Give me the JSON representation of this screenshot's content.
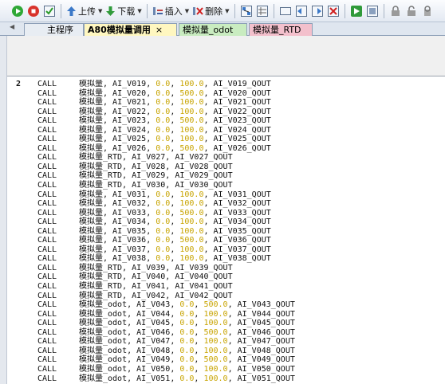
{
  "toolbar": {
    "upload_label": "上传",
    "download_label": "下载",
    "insert_label": "插入",
    "delete_label": "删除"
  },
  "tabs": [
    {
      "label": "主程序",
      "color": "#e8edf3"
    },
    {
      "label": "A80模拟量调用",
      "color": "#fff7c0",
      "active": true,
      "close": "×"
    },
    {
      "label": "模拟量_odot",
      "color": "#c9ecc0"
    },
    {
      "label": "模拟量_RTD",
      "color": "#f3c0cc"
    }
  ],
  "editor": {
    "line_number": "2",
    "lines": [
      {
        "kw": "CALL",
        "fn": "模拟量",
        "args": [
          "AI_V019",
          "0.0",
          "100.0",
          "AI_V019_QOUT"
        ]
      },
      {
        "kw": "CALL",
        "fn": "模拟量",
        "args": [
          "AI_V020",
          "0.0",
          "500.0",
          "AI_V020_QOUT"
        ]
      },
      {
        "kw": "CALL",
        "fn": "模拟量",
        "args": [
          "AI_V021",
          "0.0",
          "100.0",
          "AI_V021_QOUT"
        ]
      },
      {
        "kw": "CALL",
        "fn": "模拟量",
        "args": [
          "AI_V022",
          "0.0",
          "100.0",
          "AI_V022_QOUT"
        ]
      },
      {
        "kw": "CALL",
        "fn": "模拟量",
        "args": [
          "AI_V023",
          "0.0",
          "500.0",
          "AI_V023_QOUT"
        ]
      },
      {
        "kw": "CALL",
        "fn": "模拟量",
        "args": [
          "AI_V024",
          "0.0",
          "100.0",
          "AI_V024_QOUT"
        ]
      },
      {
        "kw": "CALL",
        "fn": "模拟量",
        "args": [
          "AI_V025",
          "0.0",
          "100.0",
          "AI_V025_QOUT"
        ]
      },
      {
        "kw": "CALL",
        "fn": "模拟量",
        "args": [
          "AI_V026",
          "0.0",
          "500.0",
          "AI_V026_QOUT"
        ]
      },
      {
        "kw": "CALL",
        "fn": "模拟量_RTD",
        "args": [
          "AI_V027",
          "AI_V027_QOUT"
        ]
      },
      {
        "kw": "CALL",
        "fn": "模拟量_RTD",
        "args": [
          "AI_V028",
          "AI_V028_QOUT"
        ]
      },
      {
        "kw": "CALL",
        "fn": "模拟量_RTD",
        "args": [
          "AI_V029",
          "AI_V029_QOUT"
        ]
      },
      {
        "kw": "CALL",
        "fn": "模拟量_RTD",
        "args": [
          "AI_V030",
          "AI_V030_QOUT"
        ]
      },
      {
        "kw": "CALL",
        "fn": "模拟量",
        "args": [
          "AI_V031",
          "0.0",
          "100.0",
          "AI_V031_QOUT"
        ]
      },
      {
        "kw": "CALL",
        "fn": "模拟量",
        "args": [
          "AI_V032",
          "0.0",
          "100.0",
          "AI_V032_QOUT"
        ]
      },
      {
        "kw": "CALL",
        "fn": "模拟量",
        "args": [
          "AI_V033",
          "0.0",
          "500.0",
          "AI_V033_QOUT"
        ]
      },
      {
        "kw": "CALL",
        "fn": "模拟量",
        "args": [
          "AI_V034",
          "0.0",
          "100.0",
          "AI_V034_QOUT"
        ]
      },
      {
        "kw": "CALL",
        "fn": "模拟量",
        "args": [
          "AI_V035",
          "0.0",
          "100.0",
          "AI_V035_QOUT"
        ]
      },
      {
        "kw": "CALL",
        "fn": "模拟量",
        "args": [
          "AI_V036",
          "0.0",
          "500.0",
          "AI_V036_QOUT"
        ]
      },
      {
        "kw": "CALL",
        "fn": "模拟量",
        "args": [
          "AI_V037",
          "0.0",
          "100.0",
          "AI_V037_QOUT"
        ]
      },
      {
        "kw": "CALL",
        "fn": "模拟量",
        "args": [
          "AI_V038",
          "0.0",
          "100.0",
          "AI_V038_QOUT"
        ]
      },
      {
        "kw": "CALL",
        "fn": "模拟量_RTD",
        "args": [
          "AI_V039",
          "AI_V039_QOUT"
        ]
      },
      {
        "kw": "CALL",
        "fn": "模拟量_RTD",
        "args": [
          "AI_V040",
          "AI_V040_QOUT"
        ]
      },
      {
        "kw": "CALL",
        "fn": "模拟量_RTD",
        "args": [
          "AI_V041",
          "AI_V041_QOUT"
        ]
      },
      {
        "kw": "CALL",
        "fn": "模拟量_RTD",
        "args": [
          "AI_V042",
          "AI_V042_QOUT"
        ]
      },
      {
        "kw": "CALL",
        "fn": "模拟量_odot",
        "args": [
          "AI_V043",
          "0.0",
          "500.0",
          "AI_V043_QOUT"
        ]
      },
      {
        "kw": "CALL",
        "fn": "模拟量_odot",
        "args": [
          "AI_V044",
          "0.0",
          "100.0",
          "AI_V044_QOUT"
        ]
      },
      {
        "kw": "CALL",
        "fn": "模拟量_odot",
        "args": [
          "AI_V045",
          "0.0",
          "100.0",
          "AI_V045_QOUT"
        ]
      },
      {
        "kw": "CALL",
        "fn": "模拟量_odot",
        "args": [
          "AI_V046",
          "0.0",
          "500.0",
          "AI_V046_QOUT"
        ]
      },
      {
        "kw": "CALL",
        "fn": "模拟量_odot",
        "args": [
          "AI_V047",
          "0.0",
          "100.0",
          "AI_V047_QOUT"
        ]
      },
      {
        "kw": "CALL",
        "fn": "模拟量_odot",
        "args": [
          "AI_V048",
          "0.0",
          "100.0",
          "AI_V048_QOUT"
        ]
      },
      {
        "kw": "CALL",
        "fn": "模拟量_odot",
        "args": [
          "AI_V049",
          "0.0",
          "500.0",
          "AI_V049_QOUT"
        ]
      },
      {
        "kw": "CALL",
        "fn": "模拟量_odot",
        "args": [
          "AI_V050",
          "0.0",
          "100.0",
          "AI_V050_QOUT"
        ]
      },
      {
        "kw": "CALL",
        "fn": "模拟量_odot",
        "args": [
          "AI_V051",
          "0.0",
          "100.0",
          "AI_V051_QOUT"
        ]
      }
    ]
  }
}
